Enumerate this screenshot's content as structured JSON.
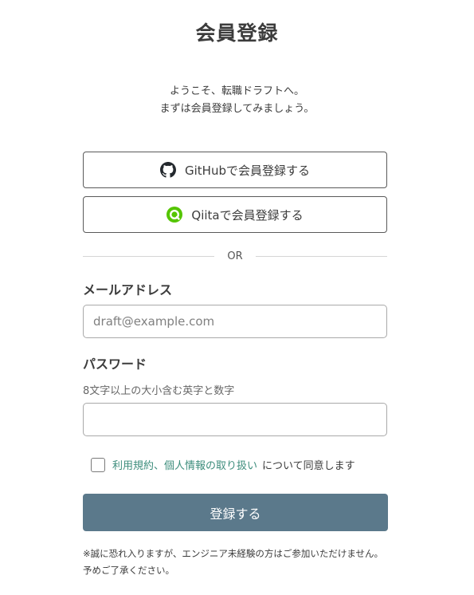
{
  "page": {
    "title": "会員登録",
    "welcome_line1": "ようこそ、転職ドラフトへ。",
    "welcome_line2": "まずは会員登録してみましょう。"
  },
  "oauth": {
    "github_label": "GitHubで会員登録する",
    "qiita_label": "Qiitaで会員登録する",
    "github_icon": "github-icon",
    "qiita_icon": "qiita-icon"
  },
  "divider": {
    "label": "OR"
  },
  "form": {
    "email_label": "メールアドレス",
    "email_placeholder": "draft@example.com",
    "email_value": "",
    "password_label": "パスワード",
    "password_hint": "8文字以上の大小含む英字と数字",
    "password_value": "",
    "terms_link": "利用規約、個人情報の取り扱い",
    "terms_suffix": "について同意します",
    "terms_checked": false,
    "submit_label": "登録する"
  },
  "footer": {
    "note": "※誠に恐れ入りますが、エンジニア未経験の方はご参加いただけません。予めご了承ください。"
  },
  "colors": {
    "submit_bg": "#5b798b",
    "link": "#3d8d7c",
    "qiita_green": "#55c500",
    "text": "#3c3c3c"
  }
}
